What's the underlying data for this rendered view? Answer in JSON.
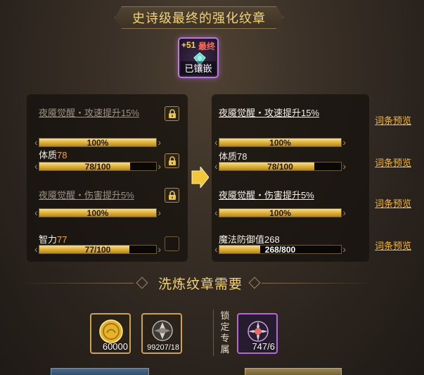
{
  "title": "史诗级最终的强化纹章",
  "emblem": {
    "level_plus": "+51",
    "final_tag": "最终",
    "inlaid_text": "已镶嵌"
  },
  "left_panel": {
    "rows": [
      {
        "label": "夜魇觉醒・攻速提升15%",
        "bar_text": "100%",
        "fill_percent": 100,
        "locked": true
      },
      {
        "label": "体质",
        "label_value": "78",
        "bar_text": "78/100",
        "fill_percent": 78,
        "locked": true
      },
      {
        "label": "夜魇觉醒・伤害提升5%",
        "bar_text": "100%",
        "fill_percent": 100,
        "locked": true
      },
      {
        "label": "智力",
        "label_value": "77",
        "bar_text": "77/100",
        "fill_percent": 77,
        "locked": false
      }
    ]
  },
  "right_panel": {
    "rows": [
      {
        "label": "夜魇觉醒・攻速提升15%",
        "bar_text": "100%",
        "fill_percent": 100,
        "preview": "词条预览"
      },
      {
        "label": "体质78",
        "bar_text": "78/100",
        "fill_percent": 78,
        "preview": "词条预览"
      },
      {
        "label": "夜魇觉醒・伤害提升5%",
        "bar_text": "100%",
        "fill_percent": 100,
        "preview": "词条预览"
      },
      {
        "label": "魔法防御值268",
        "bar_text": "268/800",
        "fill_percent": 33.5,
        "preview": "词条预览"
      }
    ]
  },
  "section_title": "洗炼纹章需要",
  "costs": {
    "gold": "60000",
    "material": "99207/18",
    "lock_label": "锁定专属",
    "exclusive": "747/6"
  },
  "colors": {
    "gold_text": "#f2d27a",
    "value_orange": "#f0a640",
    "preview_link": "#f0b93e",
    "bar_fill": "#e0b23a",
    "purple_frame": "#b46ad6"
  },
  "icons": [
    "lock-icon",
    "gem-icon",
    "arrow-right-icon",
    "gold-coin-icon",
    "material-crystal-icon",
    "exclusive-token-icon"
  ]
}
